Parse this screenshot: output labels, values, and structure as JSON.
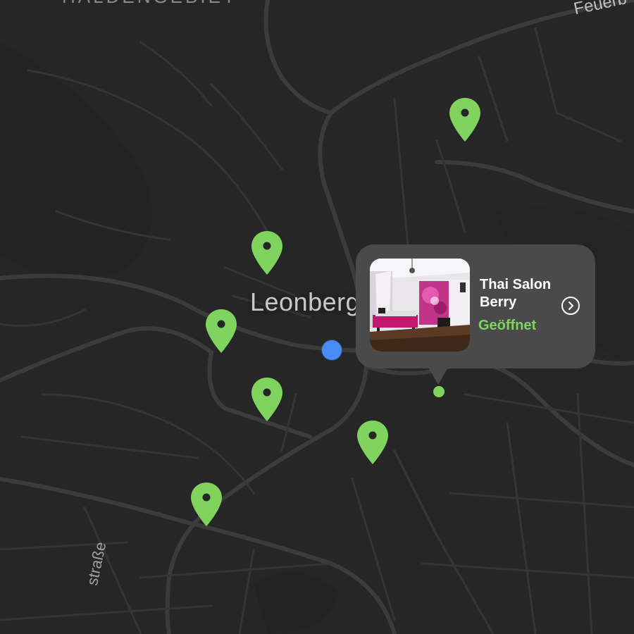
{
  "map": {
    "city_label": "Leonberg",
    "district_label": "HALDENGEBIET",
    "road_label_ne": "Feuerb",
    "road_label_sw": "straße"
  },
  "colors": {
    "background": "#262626",
    "pin": "#7fd35e",
    "user_location": "#4a8cf7",
    "callout_bg": "#4a4a4a",
    "status_open": "#7fd35e"
  },
  "markers": [
    {
      "name": "location-pin-1"
    },
    {
      "name": "location-pin-2"
    },
    {
      "name": "location-pin-3"
    },
    {
      "name": "location-pin-4"
    },
    {
      "name": "location-pin-5"
    },
    {
      "name": "location-pin-6"
    }
  ],
  "callout": {
    "title": "Thai Salon Berry",
    "status": "Geöffnet",
    "action_icon": "chevron-right-circle-icon",
    "photo": "salon-room-photo"
  }
}
